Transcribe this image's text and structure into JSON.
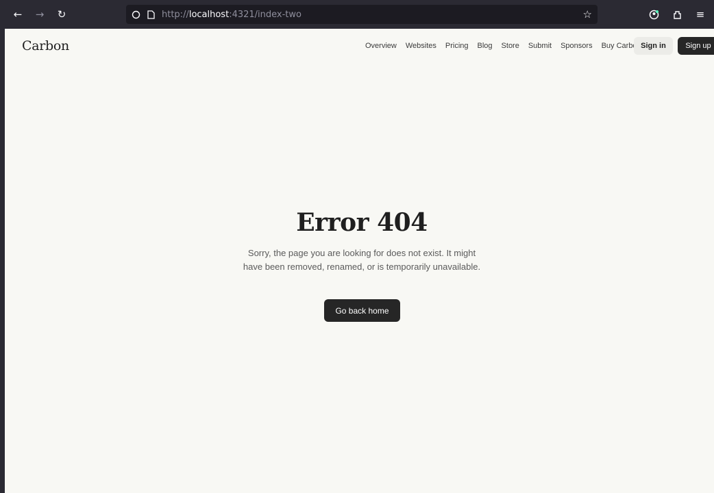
{
  "browser": {
    "url_prefix": "http://",
    "url_host": "localhost",
    "url_rest": ":4321/index-two",
    "icons": [
      "back-icon",
      "forward-icon",
      "reload-icon",
      "shield-icon",
      "page-icon",
      "star-icon",
      "account-icon",
      "extensions-icon",
      "menu-icon"
    ]
  },
  "header": {
    "logo": "Carbon",
    "nav": [
      "Overview",
      "Websites",
      "Pricing",
      "Blog",
      "Store",
      "Submit",
      "Sponsors",
      "Buy Carbon"
    ],
    "signin": "Sign in",
    "signup": "Sign up"
  },
  "main": {
    "title": "Error 404",
    "description_line1": "Sorry, the page you are looking for does not exist. It might",
    "description_line2": "have been removed, renamed, or is temporarily unavailable.",
    "home_button": "Go back home"
  },
  "colors": {
    "page_bg": "#f8f8f4",
    "chrome_bg": "#2b2a33",
    "button_dark": "#262626"
  }
}
